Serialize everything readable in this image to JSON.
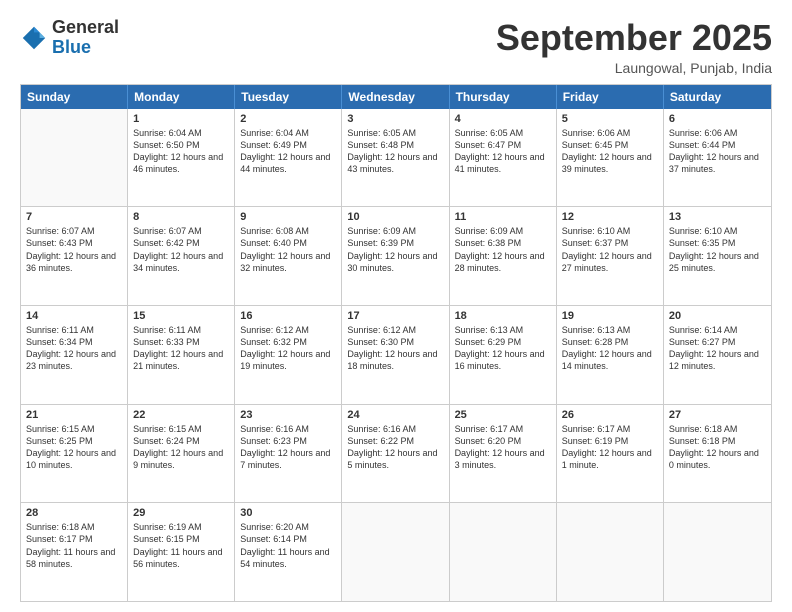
{
  "header": {
    "logo_general": "General",
    "logo_blue": "Blue",
    "month_title": "September 2025",
    "location": "Laungowal, Punjab, India"
  },
  "days": [
    "Sunday",
    "Monday",
    "Tuesday",
    "Wednesday",
    "Thursday",
    "Friday",
    "Saturday"
  ],
  "weeks": [
    [
      {
        "day": "",
        "content": ""
      },
      {
        "day": "1",
        "content": "Sunrise: 6:04 AM\nSunset: 6:50 PM\nDaylight: 12 hours\nand 46 minutes."
      },
      {
        "day": "2",
        "content": "Sunrise: 6:04 AM\nSunset: 6:49 PM\nDaylight: 12 hours\nand 44 minutes."
      },
      {
        "day": "3",
        "content": "Sunrise: 6:05 AM\nSunset: 6:48 PM\nDaylight: 12 hours\nand 43 minutes."
      },
      {
        "day": "4",
        "content": "Sunrise: 6:05 AM\nSunset: 6:47 PM\nDaylight: 12 hours\nand 41 minutes."
      },
      {
        "day": "5",
        "content": "Sunrise: 6:06 AM\nSunset: 6:45 PM\nDaylight: 12 hours\nand 39 minutes."
      },
      {
        "day": "6",
        "content": "Sunrise: 6:06 AM\nSunset: 6:44 PM\nDaylight: 12 hours\nand 37 minutes."
      }
    ],
    [
      {
        "day": "7",
        "content": "Sunrise: 6:07 AM\nSunset: 6:43 PM\nDaylight: 12 hours\nand 36 minutes."
      },
      {
        "day": "8",
        "content": "Sunrise: 6:07 AM\nSunset: 6:42 PM\nDaylight: 12 hours\nand 34 minutes."
      },
      {
        "day": "9",
        "content": "Sunrise: 6:08 AM\nSunset: 6:40 PM\nDaylight: 12 hours\nand 32 minutes."
      },
      {
        "day": "10",
        "content": "Sunrise: 6:09 AM\nSunset: 6:39 PM\nDaylight: 12 hours\nand 30 minutes."
      },
      {
        "day": "11",
        "content": "Sunrise: 6:09 AM\nSunset: 6:38 PM\nDaylight: 12 hours\nand 28 minutes."
      },
      {
        "day": "12",
        "content": "Sunrise: 6:10 AM\nSunset: 6:37 PM\nDaylight: 12 hours\nand 27 minutes."
      },
      {
        "day": "13",
        "content": "Sunrise: 6:10 AM\nSunset: 6:35 PM\nDaylight: 12 hours\nand 25 minutes."
      }
    ],
    [
      {
        "day": "14",
        "content": "Sunrise: 6:11 AM\nSunset: 6:34 PM\nDaylight: 12 hours\nand 23 minutes."
      },
      {
        "day": "15",
        "content": "Sunrise: 6:11 AM\nSunset: 6:33 PM\nDaylight: 12 hours\nand 21 minutes."
      },
      {
        "day": "16",
        "content": "Sunrise: 6:12 AM\nSunset: 6:32 PM\nDaylight: 12 hours\nand 19 minutes."
      },
      {
        "day": "17",
        "content": "Sunrise: 6:12 AM\nSunset: 6:30 PM\nDaylight: 12 hours\nand 18 minutes."
      },
      {
        "day": "18",
        "content": "Sunrise: 6:13 AM\nSunset: 6:29 PM\nDaylight: 12 hours\nand 16 minutes."
      },
      {
        "day": "19",
        "content": "Sunrise: 6:13 AM\nSunset: 6:28 PM\nDaylight: 12 hours\nand 14 minutes."
      },
      {
        "day": "20",
        "content": "Sunrise: 6:14 AM\nSunset: 6:27 PM\nDaylight: 12 hours\nand 12 minutes."
      }
    ],
    [
      {
        "day": "21",
        "content": "Sunrise: 6:15 AM\nSunset: 6:25 PM\nDaylight: 12 hours\nand 10 minutes."
      },
      {
        "day": "22",
        "content": "Sunrise: 6:15 AM\nSunset: 6:24 PM\nDaylight: 12 hours\nand 9 minutes."
      },
      {
        "day": "23",
        "content": "Sunrise: 6:16 AM\nSunset: 6:23 PM\nDaylight: 12 hours\nand 7 minutes."
      },
      {
        "day": "24",
        "content": "Sunrise: 6:16 AM\nSunset: 6:22 PM\nDaylight: 12 hours\nand 5 minutes."
      },
      {
        "day": "25",
        "content": "Sunrise: 6:17 AM\nSunset: 6:20 PM\nDaylight: 12 hours\nand 3 minutes."
      },
      {
        "day": "26",
        "content": "Sunrise: 6:17 AM\nSunset: 6:19 PM\nDaylight: 12 hours\nand 1 minute."
      },
      {
        "day": "27",
        "content": "Sunrise: 6:18 AM\nSunset: 6:18 PM\nDaylight: 12 hours\nand 0 minutes."
      }
    ],
    [
      {
        "day": "28",
        "content": "Sunrise: 6:18 AM\nSunset: 6:17 PM\nDaylight: 11 hours\nand 58 minutes."
      },
      {
        "day": "29",
        "content": "Sunrise: 6:19 AM\nSunset: 6:15 PM\nDaylight: 11 hours\nand 56 minutes."
      },
      {
        "day": "30",
        "content": "Sunrise: 6:20 AM\nSunset: 6:14 PM\nDaylight: 11 hours\nand 54 minutes."
      },
      {
        "day": "",
        "content": ""
      },
      {
        "day": "",
        "content": ""
      },
      {
        "day": "",
        "content": ""
      },
      {
        "day": "",
        "content": ""
      }
    ]
  ]
}
